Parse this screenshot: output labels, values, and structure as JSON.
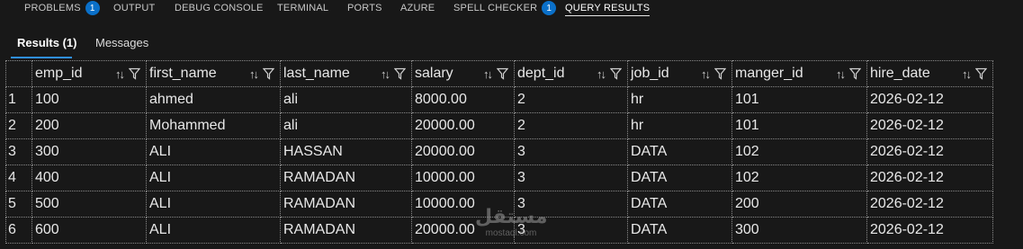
{
  "panel_tabs": [
    {
      "label": "PROBLEMS",
      "badge": "1"
    },
    {
      "label": "OUTPUT"
    },
    {
      "label": "DEBUG CONSOLE"
    },
    {
      "label": "TERMINAL"
    },
    {
      "label": "PORTS"
    },
    {
      "label": "AZURE"
    },
    {
      "label": "SPELL CHECKER",
      "badge": "1"
    },
    {
      "label": "QUERY RESULTS",
      "active": true
    }
  ],
  "sub_tabs": [
    {
      "label": "Results (1)",
      "active": true
    },
    {
      "label": "Messages"
    }
  ],
  "table": {
    "columns": [
      "emp_id",
      "first_name",
      "last_name",
      "salary",
      "dept_id",
      "job_id",
      "manger_id",
      "hire_date"
    ],
    "rows": [
      {
        "n": "1",
        "cells": [
          "100",
          "ahmed",
          "ali",
          "8000.00",
          "2",
          "hr",
          "101",
          "2026-02-12"
        ]
      },
      {
        "n": "2",
        "cells": [
          "200",
          "Mohammed",
          "ali",
          "20000.00",
          "2",
          "hr",
          "101",
          "2026-02-12"
        ]
      },
      {
        "n": "3",
        "cells": [
          "300",
          "ALI",
          "HASSAN",
          "20000.00",
          "3",
          "DATA",
          "102",
          "2026-02-12"
        ]
      },
      {
        "n": "4",
        "cells": [
          "400",
          "ALI",
          "RAMADAN",
          "10000.00",
          "3",
          "DATA",
          "102",
          "2026-02-12"
        ]
      },
      {
        "n": "5",
        "cells": [
          "500",
          "ALI",
          "RAMADAN",
          "10000.00",
          "3",
          "DATA",
          "200",
          "2026-02-12"
        ]
      },
      {
        "n": "6",
        "cells": [
          "600",
          "ALI",
          "RAMADAN",
          "20000.00",
          "3",
          "DATA",
          "300",
          "2026-02-12"
        ]
      }
    ]
  },
  "watermark": {
    "logo": "مستقل",
    "text": "mostaql.com"
  },
  "colors": {
    "background": "#181818",
    "badge": "#0a70c9",
    "active_underline": "#2f8fe8"
  },
  "icons": {
    "sort": "sort-icon",
    "filter": "filter-icon"
  }
}
